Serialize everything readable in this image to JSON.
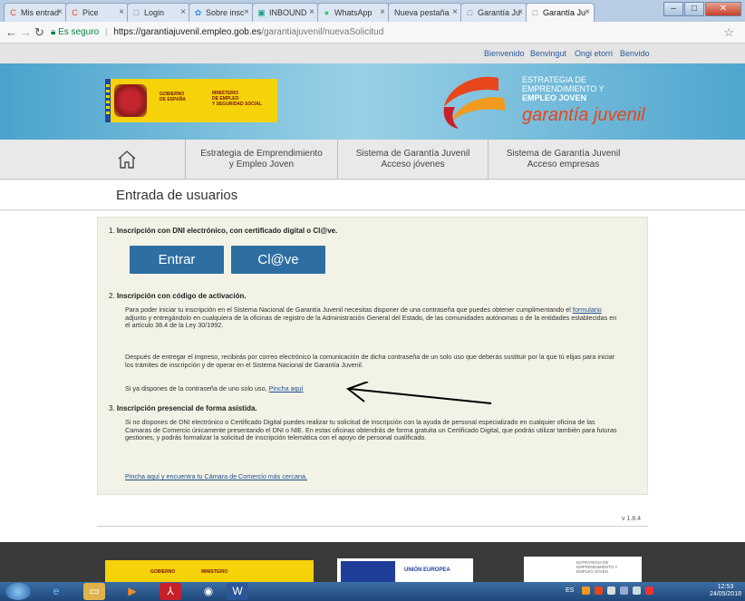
{
  "browser": {
    "tabs": [
      {
        "title": "Mis entrad",
        "icon": "C",
        "color": "#e8461b"
      },
      {
        "title": "Pice",
        "icon": "C",
        "color": "#e8461b"
      },
      {
        "title": "Login",
        "icon": "□",
        "color": "#777"
      },
      {
        "title": "Sobre insc",
        "icon": "✿",
        "color": "#3a8dde"
      },
      {
        "title": "INBOUND",
        "icon": "▣",
        "color": "#1aa08a"
      },
      {
        "title": "WhatsApp",
        "icon": "●",
        "color": "#25d366"
      },
      {
        "title": "Nueva pestaña",
        "icon": "",
        "color": "#777"
      },
      {
        "title": "Garantía Ju",
        "icon": "□",
        "color": "#777"
      },
      {
        "title": "Garantía Ju",
        "icon": "□",
        "color": "#777"
      }
    ],
    "secure_label": "Es seguro",
    "url_host": "https://garantiajuvenil.empleo.gob.es",
    "url_path": "/garantiajuvenil/nuevaSolicitud",
    "min": "–",
    "max": "□",
    "close": "✕"
  },
  "top_links": [
    "Bienvenido",
    "Benvingut",
    "Ongi etorri",
    "Benvido"
  ],
  "banner": {
    "gov_line1": "GOBIERNO",
    "gov_line2": "DE ESPAÑA",
    "min_line1": "MINISTERIO",
    "min_line2": "DE EMPLEO",
    "min_line3": "Y SEGURIDAD SOCIAL",
    "gj_line1": "ESTRATEGIA DE",
    "gj_line2": "EMPRENDIMIENTO Y",
    "gj_line3": "EMPLEO JOVEN",
    "gj_big": "garantía juvenil"
  },
  "nav": [
    {
      "line1": "Estrategia de Emprendimiento",
      "line2": "y Empleo Joven"
    },
    {
      "line1": "Sistema de Garantía Juvenil",
      "line2": "Acceso jóvenes"
    },
    {
      "line1": "Sistema de Garantía Juvenil",
      "line2": "Acceso empresas"
    }
  ],
  "page_title": "Entrada de usuarios",
  "section1": {
    "num": "1.",
    "title": "Inscripción con DNI electrónico, con certificado digital o Cl@ve.",
    "btn_enter": "Entrar",
    "btn_clave": "Cl@ve"
  },
  "section2": {
    "num": "2.",
    "title": "Inscripción con código de activación.",
    "p1_a": "Para poder iniciar tu inscripción en el Sistema Nacional de Garantía Juvenil necesitas disponer de una contraseña que puedes obtener cumplimentando el ",
    "p1_link": "formulario ",
    "p1_b": "adjunto y entregándolo en cualquiera de la oficinas de registro de la Administración General del Estado, de las comunidades autónomas o de la entidades establecidas en el artículo 38.4 de la Ley 30/1992.",
    "p2": "Después de entregar el impreso, recibirás por correo electrónico la comunicación de dicha contraseña de un solo uso que deberás sustituir por la que tú elijas para iniciar los trámites de inscripción y de operar en el Sistema Nacional de Garantía Juvenil.",
    "p3_a": "Si ya dispones de la contraseña de uno solo uso, ",
    "p3_link": "Pincha aquí"
  },
  "section3": {
    "num": "3.",
    "title": "Inscripción presencial de forma asistida.",
    "p1": "Si no dispones de DNI electrónico o Certificado Digital puedes realizar tu solicitud de inscripción con la ayuda de personal especializado en cualquier oficina de las Camaras de Comercio únicamente presentando el DNI o NIE. En estas oficinas obtendrás de forma gratuita un Certificado Digital, que podrás utilizar también para futuras gestiones, y podrás formalizar la solicitud de inscripción telemática con el apoyo de personal cualificado.",
    "link": "Pincha aquí y encuentra tu Cámara de Comercio más cercana."
  },
  "version": "v 1.8.4",
  "footer": {
    "gov": "GOBIERNO",
    "min": "MINISTERIO",
    "eu": "UNIÓN EUROPEA",
    "gj_line1": "ESTRATEGIA DE",
    "gj_line2": "EMPRENDIMIENTO Y",
    "gj_line3": "EMPLEO JOVEN"
  },
  "taskbar": {
    "time": "12:53",
    "date": "24/05/2018",
    "lang": "ES"
  },
  "colors": {
    "accent_blue": "#2d6fa3",
    "gj_orange": "#e8461b",
    "gov_yellow": "#f5d20a"
  }
}
